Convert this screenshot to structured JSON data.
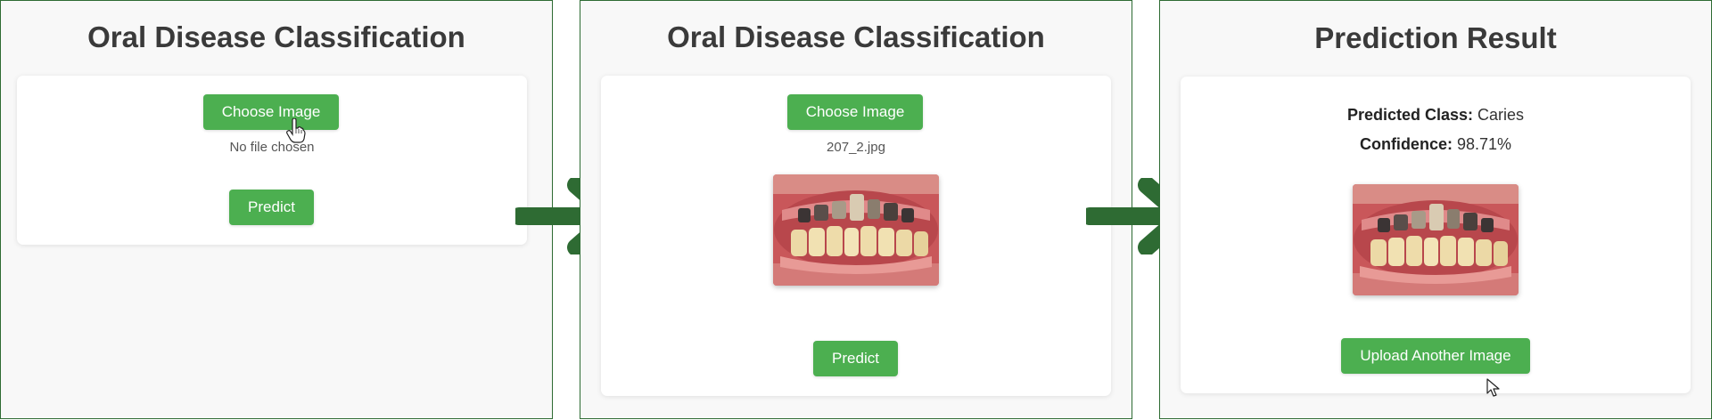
{
  "panel1": {
    "title": "Oral Disease Classification",
    "choose_label": "Choose Image",
    "file_status": "No file chosen",
    "predict_label": "Predict"
  },
  "panel2": {
    "title": "Oral Disease Classification",
    "choose_label": "Choose Image",
    "file_status": "207_2.jpg",
    "predict_label": "Predict",
    "image_name": "dental-photo-caries"
  },
  "panel3": {
    "title": "Prediction Result",
    "class_label": "Predicted Class:",
    "class_value": "Caries",
    "confidence_label": "Confidence:",
    "confidence_value": "98.71%",
    "upload_label": "Upload Another Image",
    "image_name": "dental-photo-caries"
  },
  "colors": {
    "button": "#4caf50",
    "arrow": "#2e6b33",
    "panel_border": "#2e6b33",
    "panel_bg": "#f8f8f8"
  }
}
